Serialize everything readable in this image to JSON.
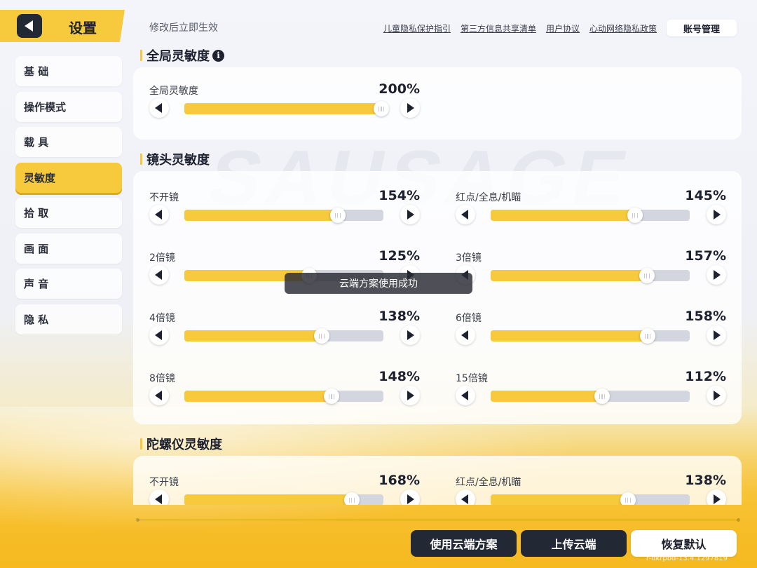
{
  "header": {
    "title": "设置",
    "hint": "修改后立即生效",
    "links": [
      "儿童隐私保护指引",
      "第三方信息共享清单",
      "用户协议",
      "心动网络隐私政策"
    ],
    "account_button": "账号管理"
  },
  "sidebar": {
    "items": [
      {
        "label": "基 础",
        "active": false
      },
      {
        "label": "操作模式",
        "active": false
      },
      {
        "label": "载 具",
        "active": false
      },
      {
        "label": "灵敏度",
        "active": true
      },
      {
        "label": "拾 取",
        "active": false
      },
      {
        "label": "画 面",
        "active": false
      },
      {
        "label": "声 音",
        "active": false
      },
      {
        "label": "隐 私",
        "active": false
      }
    ]
  },
  "sections": {
    "global": {
      "title": "全局灵敏度",
      "sliders": [
        {
          "label": "全局灵敏度",
          "value": "200%",
          "fraction": 0.99
        }
      ]
    },
    "camera": {
      "title": "镜头灵敏度",
      "sliders": [
        {
          "label": "不开镜",
          "value": "154%",
          "fraction": 0.77
        },
        {
          "label": "红点/全息/机瞄",
          "value": "145%",
          "fraction": 0.725
        },
        {
          "label": "2倍镜",
          "value": "125%",
          "fraction": 0.625
        },
        {
          "label": "3倍镜",
          "value": "157%",
          "fraction": 0.785
        },
        {
          "label": "4倍镜",
          "value": "138%",
          "fraction": 0.69
        },
        {
          "label": "6倍镜",
          "value": "158%",
          "fraction": 0.79
        },
        {
          "label": "8倍镜",
          "value": "148%",
          "fraction": 0.74
        },
        {
          "label": "15倍镜",
          "value": "112%",
          "fraction": 0.56
        }
      ]
    },
    "gyro": {
      "title": "陀螺仪灵敏度",
      "sliders": [
        {
          "label": "不开镜",
          "value": "168%",
          "fraction": 0.84
        },
        {
          "label": "红点/全息/机瞄",
          "value": "138%",
          "fraction": 0.69
        }
      ]
    }
  },
  "toast": "云端方案使用成功",
  "footer": {
    "use_cloud": "使用云端方案",
    "upload_cloud": "上传云端",
    "restore_default": "恢复默认",
    "version": "r-dkrpbd-13.4.1297819"
  },
  "colors": {
    "accent": "#f7c93d",
    "dark": "#222834"
  },
  "watermark": "SAUSAGE"
}
